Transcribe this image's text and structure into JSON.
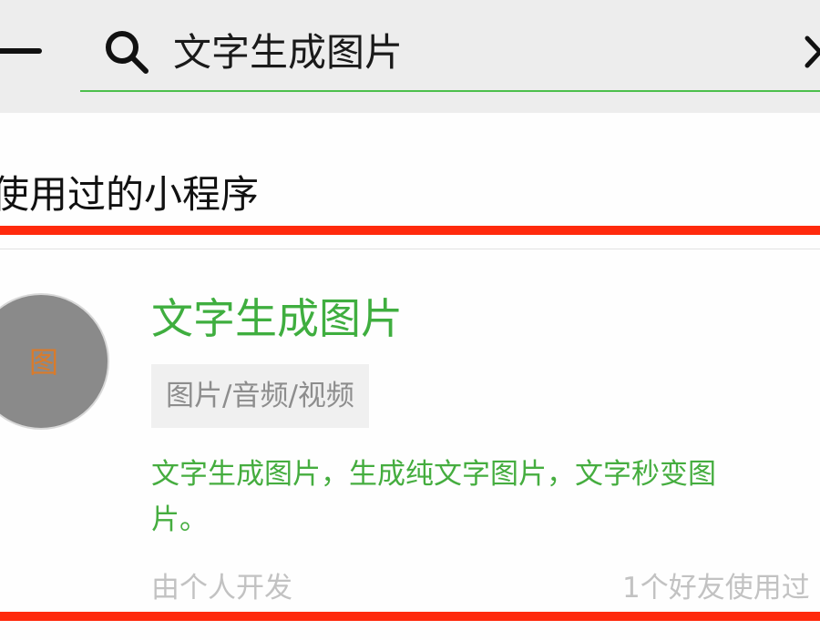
{
  "header": {
    "search_value": "文字生成图片",
    "back_icon": "back-arrow-icon",
    "search_icon": "search-icon",
    "clear_icon": "close-icon",
    "underline_color": "#4cbf4c"
  },
  "section": {
    "title": "使用过的小程序"
  },
  "result": {
    "avatar_glyph": "图",
    "title": "文字生成图片",
    "category": "图片/音频/视频",
    "description_lines": [
      "文字生成图片，生成纯文字图片，文字秒变图",
      "片。"
    ],
    "developer": "由个人开发",
    "friends_used": "1个好友使用过",
    "accent_color": "#3fae3f"
  },
  "annotation": {
    "highlight_color": "#ff2a0d"
  }
}
